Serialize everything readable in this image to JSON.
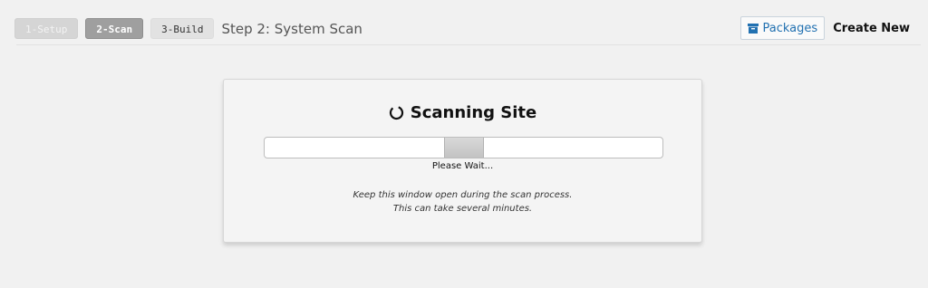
{
  "header": {
    "steps": [
      {
        "label": "1-Setup",
        "state": "done"
      },
      {
        "label": "2-Scan",
        "state": "active"
      },
      {
        "label": "3-Build",
        "state": "todo"
      }
    ],
    "title": "Step 2: System Scan",
    "packages_label": "Packages",
    "create_new_label": "Create New"
  },
  "scan": {
    "title": "Scanning Site",
    "status": "Please Wait...",
    "notice_line1": "Keep this window open during the scan process.",
    "notice_line2": "This can take several minutes.",
    "progress_indeterminate_position": 0.5
  },
  "icons": {
    "packages": "archive-box-icon",
    "spinner": "spinner-icon"
  },
  "colors": {
    "link": "#2271b1",
    "background": "#f1f1f1"
  }
}
